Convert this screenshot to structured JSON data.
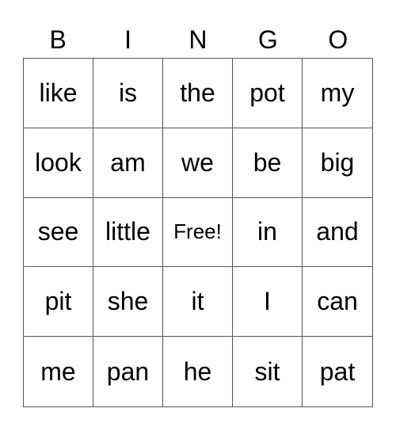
{
  "header": [
    "B",
    "I",
    "N",
    "G",
    "O"
  ],
  "rows": [
    [
      "like",
      "is",
      "the",
      "pot",
      "my"
    ],
    [
      "look",
      "am",
      "we",
      "be",
      "big"
    ],
    [
      "see",
      "little",
      "Free!",
      "in",
      "and"
    ],
    [
      "pit",
      "she",
      "it",
      "I",
      "can"
    ],
    [
      "me",
      "pan",
      "he",
      "sit",
      "pat"
    ]
  ]
}
